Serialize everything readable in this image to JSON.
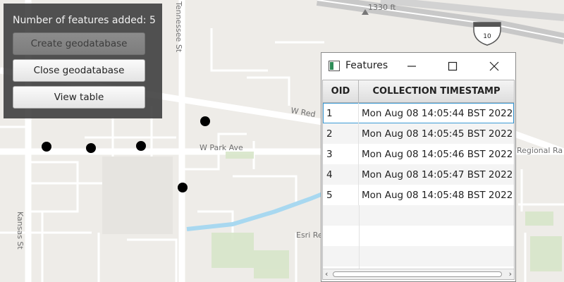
{
  "map": {
    "labels": {
      "elevation": "1330 ft",
      "tennessee_st": "Tennessee St",
      "kansas_st": "Kansas St",
      "w_red": "W Red",
      "w_park_ave": "W Park Ave",
      "regional": "Regional Ra",
      "esri": "Esri Re",
      "shield_number": "10"
    },
    "colors": {
      "background": "#eeece8",
      "road": "#ffffff",
      "highway": "#cfcfcf",
      "water": "#a8d8f0",
      "vegetation": "#d7e6c9",
      "point": "#000000"
    }
  },
  "panel": {
    "title": "Number of features added: 5",
    "buttons": {
      "create": "Create geodatabase",
      "close": "Close geodatabase",
      "view": "View table"
    }
  },
  "window": {
    "title": "Features",
    "icons": {
      "minimize": "minimize-icon",
      "maximize": "maximize-icon",
      "close": "close-icon"
    },
    "table": {
      "headers": {
        "oid": "OID",
        "timestamp": "COLLECTION TIMESTAMP"
      },
      "rows": [
        {
          "oid": "1",
          "timestamp": "Mon Aug 08 14:05:44 BST 2022"
        },
        {
          "oid": "2",
          "timestamp": "Mon Aug 08 14:05:45 BST 2022"
        },
        {
          "oid": "3",
          "timestamp": "Mon Aug 08 14:05:46 BST 2022"
        },
        {
          "oid": "4",
          "timestamp": "Mon Aug 08 14:05:47 BST 2022"
        },
        {
          "oid": "5",
          "timestamp": "Mon Aug 08 14:05:48 BST 2022"
        }
      ]
    }
  }
}
